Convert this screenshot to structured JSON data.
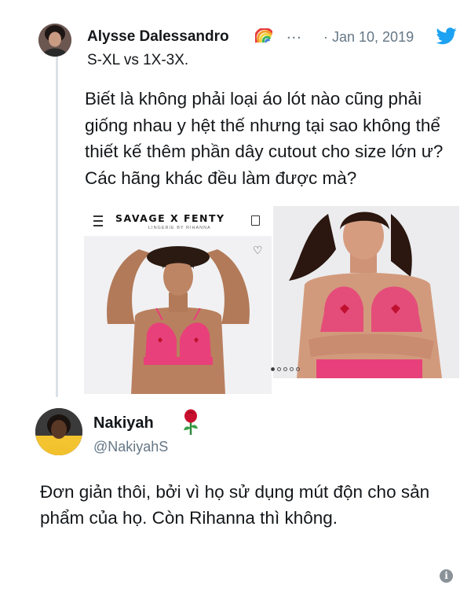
{
  "tweet1": {
    "author_name": "Alysse Dalessandro",
    "more": "...",
    "date": "· Jan 10, 2019",
    "reply_text": "S-XL vs 1X-3X.",
    "body": "Biết là không phải loại áo lót nào cũng phải giống nhau y hệt thế nhưng tại sao không thể thiết kế thêm phần dây cutout cho size lớn ư? Các hãng khác đều làm được mà?",
    "media": {
      "brand": "SAVAGE X FENTY",
      "brand_sub": "LINGERIE BY RIHANNA",
      "pager": {
        "count": 5,
        "active": 0
      }
    }
  },
  "tweet2": {
    "author_name": "Nakiyah",
    "handle": "@NakiyahS",
    "body": "Đơn giản thôi, bởi vì họ sử dụng mút độn cho sản phẩm của họ. Còn Rihanna thì không."
  },
  "footer": {
    "info_glyph": "i"
  },
  "colors": {
    "twitter_blue": "#1da1f2",
    "muted": "#657786",
    "text": "#14171a",
    "bra_pink": "#e8407a",
    "thread_line": "#dbe1e6"
  },
  "icons": [
    "rainbow-emoji",
    "twitter-bird-icon",
    "menu-icon",
    "bag-icon",
    "heart-outline-icon",
    "rose-emoji",
    "info-icon"
  ]
}
